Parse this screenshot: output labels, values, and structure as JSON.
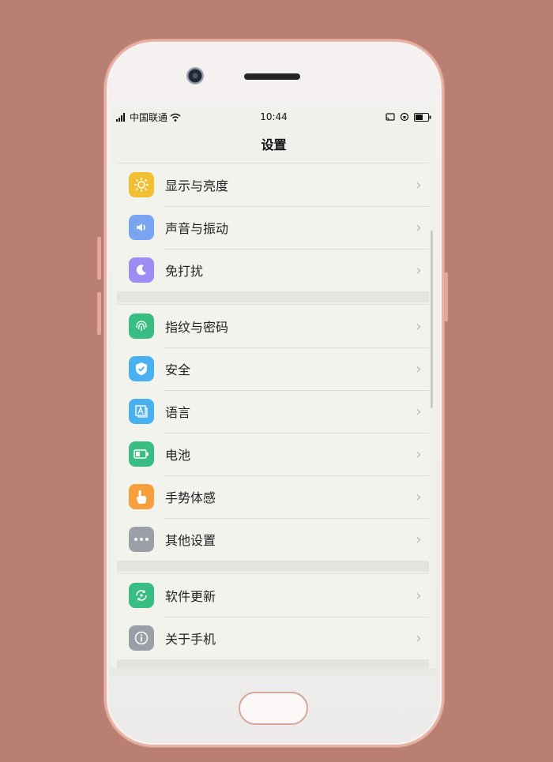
{
  "status": {
    "carrier": "中国联通",
    "time": "10:44"
  },
  "nav": {
    "title": "设置"
  },
  "colors": {
    "display": "#f2bf32",
    "sound": "#7aa4f2",
    "dnd": "#9c8cf3",
    "fingerprint": "#38be82",
    "security": "#4ab1f0",
    "language": "#4ab1f0",
    "battery": "#38be82",
    "gesture": "#f5a03c",
    "other": "#9aa0a6",
    "update": "#38be82",
    "about": "#9aa0a6"
  },
  "groups": [
    {
      "items": [
        {
          "label": "显示与亮度",
          "icon": "sun-icon"
        },
        {
          "label": "声音与振动",
          "icon": "speaker-icon"
        },
        {
          "label": "免打扰",
          "icon": "moon-icon"
        }
      ]
    },
    {
      "items": [
        {
          "label": "指纹与密码",
          "icon": "fingerprint-icon"
        },
        {
          "label": "安全",
          "icon": "shield-icon"
        },
        {
          "label": "语言",
          "icon": "language-icon"
        },
        {
          "label": "电池",
          "icon": "battery-icon"
        },
        {
          "label": "手势体感",
          "icon": "hand-gesture-icon"
        },
        {
          "label": "其他设置",
          "icon": "more-icon"
        }
      ]
    },
    {
      "items": [
        {
          "label": "软件更新",
          "icon": "refresh-icon"
        },
        {
          "label": "关于手机",
          "icon": "info-icon"
        }
      ]
    }
  ]
}
